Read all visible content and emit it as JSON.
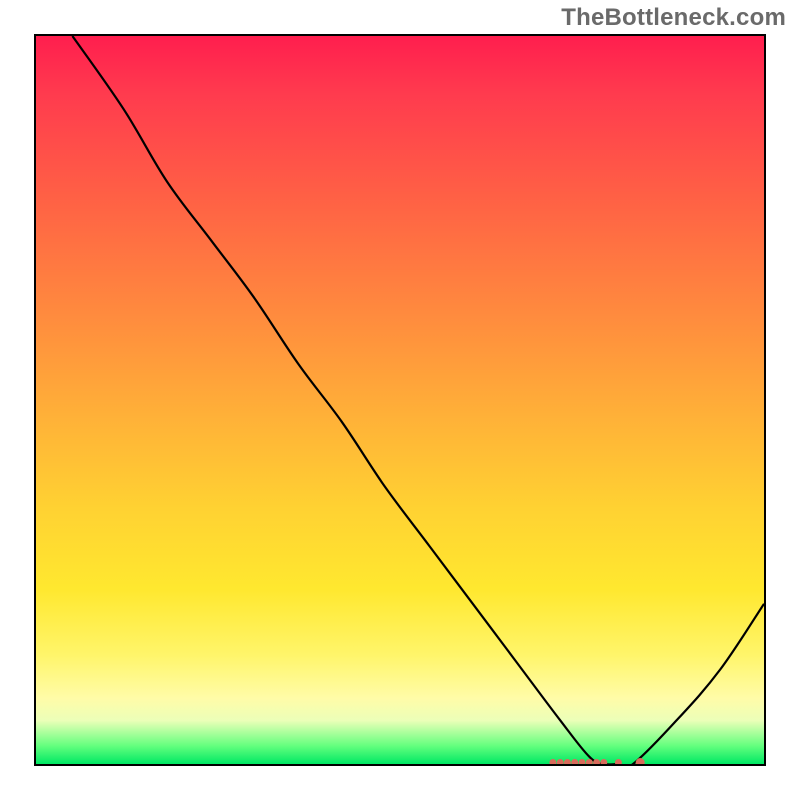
{
  "watermark": "TheBottleneck.com",
  "chart_data": {
    "type": "line",
    "title": "",
    "xlabel": "",
    "ylabel": "",
    "xlim": [
      0,
      100
    ],
    "ylim": [
      0,
      100
    ],
    "grid": false,
    "legend": false,
    "x": [
      5,
      12,
      18,
      24,
      30,
      36,
      42,
      48,
      54,
      60,
      66,
      72,
      76,
      78,
      80,
      82,
      88,
      94,
      100
    ],
    "y": [
      100,
      90,
      80,
      72,
      64,
      55,
      47,
      38,
      30,
      22,
      14,
      6,
      1,
      0,
      0,
      0,
      6,
      13,
      22
    ],
    "flat_segment_x": [
      70,
      83
    ],
    "markers_x": [
      71,
      72,
      73,
      74,
      75,
      76,
      77,
      78,
      80,
      83
    ],
    "note": "Values are percentages of plot area; y measured from bottom. Curve descends from top-left, bottoms out near x≈78, then rises toward the right edge. Small salmon/red markers occupy the flat bottom segment."
  }
}
